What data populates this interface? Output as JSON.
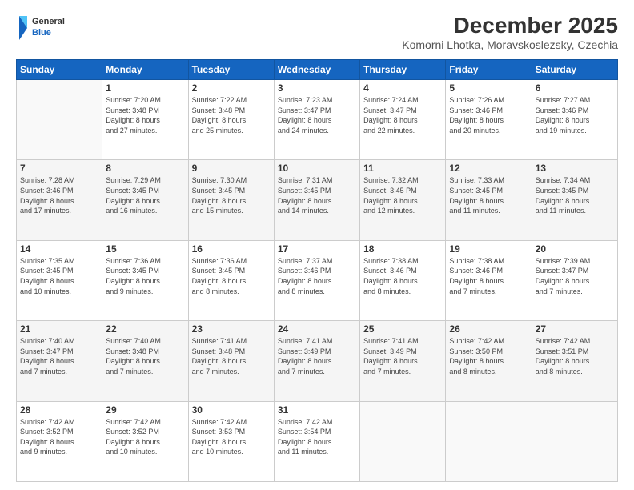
{
  "header": {
    "logo": {
      "text_general": "General",
      "text_blue": "Blue"
    },
    "title": "December 2025",
    "subtitle": "Komorni Lhotka, Moravskoslezsky, Czechia"
  },
  "calendar": {
    "days_of_week": [
      "Sunday",
      "Monday",
      "Tuesday",
      "Wednesday",
      "Thursday",
      "Friday",
      "Saturday"
    ],
    "weeks": [
      [
        {
          "day": "",
          "info": ""
        },
        {
          "day": "1",
          "info": "Sunrise: 7:20 AM\nSunset: 3:48 PM\nDaylight: 8 hours\nand 27 minutes."
        },
        {
          "day": "2",
          "info": "Sunrise: 7:22 AM\nSunset: 3:48 PM\nDaylight: 8 hours\nand 25 minutes."
        },
        {
          "day": "3",
          "info": "Sunrise: 7:23 AM\nSunset: 3:47 PM\nDaylight: 8 hours\nand 24 minutes."
        },
        {
          "day": "4",
          "info": "Sunrise: 7:24 AM\nSunset: 3:47 PM\nDaylight: 8 hours\nand 22 minutes."
        },
        {
          "day": "5",
          "info": "Sunrise: 7:26 AM\nSunset: 3:46 PM\nDaylight: 8 hours\nand 20 minutes."
        },
        {
          "day": "6",
          "info": "Sunrise: 7:27 AM\nSunset: 3:46 PM\nDaylight: 8 hours\nand 19 minutes."
        }
      ],
      [
        {
          "day": "7",
          "info": "Sunrise: 7:28 AM\nSunset: 3:46 PM\nDaylight: 8 hours\nand 17 minutes."
        },
        {
          "day": "8",
          "info": "Sunrise: 7:29 AM\nSunset: 3:45 PM\nDaylight: 8 hours\nand 16 minutes."
        },
        {
          "day": "9",
          "info": "Sunrise: 7:30 AM\nSunset: 3:45 PM\nDaylight: 8 hours\nand 15 minutes."
        },
        {
          "day": "10",
          "info": "Sunrise: 7:31 AM\nSunset: 3:45 PM\nDaylight: 8 hours\nand 14 minutes."
        },
        {
          "day": "11",
          "info": "Sunrise: 7:32 AM\nSunset: 3:45 PM\nDaylight: 8 hours\nand 12 minutes."
        },
        {
          "day": "12",
          "info": "Sunrise: 7:33 AM\nSunset: 3:45 PM\nDaylight: 8 hours\nand 11 minutes."
        },
        {
          "day": "13",
          "info": "Sunrise: 7:34 AM\nSunset: 3:45 PM\nDaylight: 8 hours\nand 11 minutes."
        }
      ],
      [
        {
          "day": "14",
          "info": "Sunrise: 7:35 AM\nSunset: 3:45 PM\nDaylight: 8 hours\nand 10 minutes."
        },
        {
          "day": "15",
          "info": "Sunrise: 7:36 AM\nSunset: 3:45 PM\nDaylight: 8 hours\nand 9 minutes."
        },
        {
          "day": "16",
          "info": "Sunrise: 7:36 AM\nSunset: 3:45 PM\nDaylight: 8 hours\nand 8 minutes."
        },
        {
          "day": "17",
          "info": "Sunrise: 7:37 AM\nSunset: 3:46 PM\nDaylight: 8 hours\nand 8 minutes."
        },
        {
          "day": "18",
          "info": "Sunrise: 7:38 AM\nSunset: 3:46 PM\nDaylight: 8 hours\nand 8 minutes."
        },
        {
          "day": "19",
          "info": "Sunrise: 7:38 AM\nSunset: 3:46 PM\nDaylight: 8 hours\nand 7 minutes."
        },
        {
          "day": "20",
          "info": "Sunrise: 7:39 AM\nSunset: 3:47 PM\nDaylight: 8 hours\nand 7 minutes."
        }
      ],
      [
        {
          "day": "21",
          "info": "Sunrise: 7:40 AM\nSunset: 3:47 PM\nDaylight: 8 hours\nand 7 minutes."
        },
        {
          "day": "22",
          "info": "Sunrise: 7:40 AM\nSunset: 3:48 PM\nDaylight: 8 hours\nand 7 minutes."
        },
        {
          "day": "23",
          "info": "Sunrise: 7:41 AM\nSunset: 3:48 PM\nDaylight: 8 hours\nand 7 minutes."
        },
        {
          "day": "24",
          "info": "Sunrise: 7:41 AM\nSunset: 3:49 PM\nDaylight: 8 hours\nand 7 minutes."
        },
        {
          "day": "25",
          "info": "Sunrise: 7:41 AM\nSunset: 3:49 PM\nDaylight: 8 hours\nand 7 minutes."
        },
        {
          "day": "26",
          "info": "Sunrise: 7:42 AM\nSunset: 3:50 PM\nDaylight: 8 hours\nand 8 minutes."
        },
        {
          "day": "27",
          "info": "Sunrise: 7:42 AM\nSunset: 3:51 PM\nDaylight: 8 hours\nand 8 minutes."
        }
      ],
      [
        {
          "day": "28",
          "info": "Sunrise: 7:42 AM\nSunset: 3:52 PM\nDaylight: 8 hours\nand 9 minutes."
        },
        {
          "day": "29",
          "info": "Sunrise: 7:42 AM\nSunset: 3:52 PM\nDaylight: 8 hours\nand 10 minutes."
        },
        {
          "day": "30",
          "info": "Sunrise: 7:42 AM\nSunset: 3:53 PM\nDaylight: 8 hours\nand 10 minutes."
        },
        {
          "day": "31",
          "info": "Sunrise: 7:42 AM\nSunset: 3:54 PM\nDaylight: 8 hours\nand 11 minutes."
        },
        {
          "day": "",
          "info": ""
        },
        {
          "day": "",
          "info": ""
        },
        {
          "day": "",
          "info": ""
        }
      ]
    ]
  }
}
